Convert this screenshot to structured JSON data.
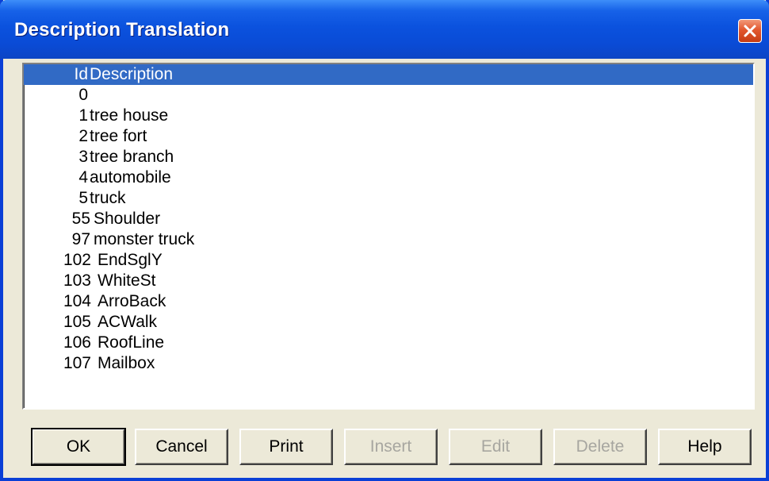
{
  "window": {
    "title": "Description Translation"
  },
  "list": {
    "header": {
      "id": "Id",
      "description": "Description"
    },
    "rows": [
      {
        "id": "0",
        "description": ""
      },
      {
        "id": "1",
        "description": "tree house"
      },
      {
        "id": "2",
        "description": "tree fort"
      },
      {
        "id": "3",
        "description": "tree branch"
      },
      {
        "id": "4",
        "description": "automobile"
      },
      {
        "id": "5",
        "description": "truck"
      },
      {
        "id": "55",
        "description": "Shoulder"
      },
      {
        "id": "97",
        "description": "monster truck"
      },
      {
        "id": "102",
        "description": "EndSglY"
      },
      {
        "id": "103",
        "description": "WhiteSt"
      },
      {
        "id": "104",
        "description": "ArroBack"
      },
      {
        "id": "105",
        "description": "ACWalk"
      },
      {
        "id": "106",
        "description": "RoofLine"
      },
      {
        "id": "107",
        "description": "Mailbox"
      }
    ]
  },
  "buttons": {
    "ok": "OK",
    "cancel": "Cancel",
    "print": "Print",
    "insert": "Insert",
    "edit": "Edit",
    "delete": "Delete",
    "help": "Help"
  },
  "colors": {
    "titlebar": "#0a4bd6",
    "selection": "#316ac5",
    "close_button": "#e2572e",
    "disabled_text": "#a7a6a0"
  },
  "icons": {
    "close": "close-icon"
  }
}
